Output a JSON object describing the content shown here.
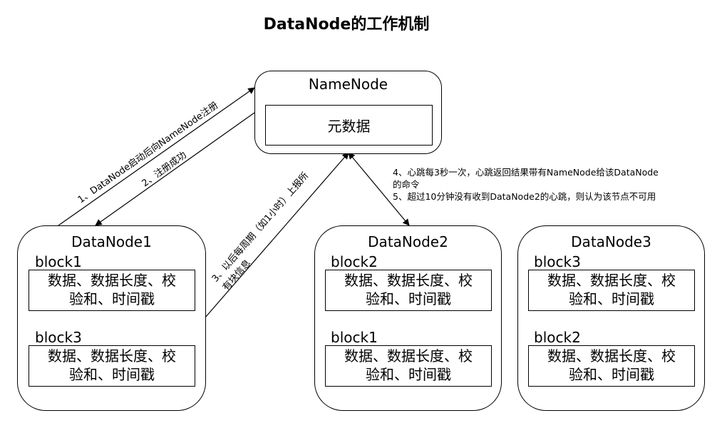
{
  "title": "DataNode的工作机制",
  "namenode": {
    "label": "NameNode",
    "metadata": "元数据"
  },
  "datanodes": [
    {
      "label": "DataNode1",
      "blocks": [
        {
          "name": "block1",
          "content_line1": "数据、数据长度、校",
          "content_line2": "验和、时间戳"
        },
        {
          "name": "block3",
          "content_line1": "数据、数据长度、校",
          "content_line2": "验和、时间戳"
        }
      ]
    },
    {
      "label": "DataNode2",
      "blocks": [
        {
          "name": "block2",
          "content_line1": "数据、数据长度、校",
          "content_line2": "验和、时间戳"
        },
        {
          "name": "block1",
          "content_line1": "数据、数据长度、校",
          "content_line2": "验和、时间戳"
        }
      ]
    },
    {
      "label": "DataNode3",
      "blocks": [
        {
          "name": "block3",
          "content_line1": "数据、数据长度、校",
          "content_line2": "验和、时间戳"
        },
        {
          "name": "block2",
          "content_line1": "数据、数据长度、校",
          "content_line2": "验和、时间戳"
        }
      ]
    }
  ],
  "edges": {
    "register": "1、DataNode启动后向NameNode注册",
    "register_ok": "2、注册成功",
    "report_line1": "3、以后每周期（如1小时）上报所",
    "report_line2": "有块信息"
  },
  "notes": {
    "line1": "4、心跳每3秒一次，心跳返回结果带有NameNode给该DataNode",
    "line2": "的命令",
    "line3": "5、超过10分钟没有收到DataNode2的心跳，则认为该节点不可用"
  }
}
